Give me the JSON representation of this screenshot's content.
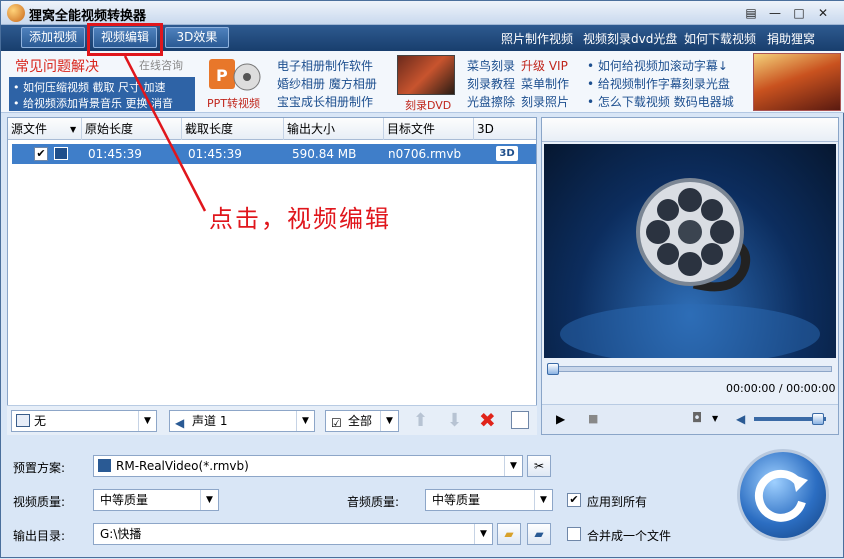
{
  "app": {
    "title": "狸窝全能视频转换器"
  },
  "window_controls": {
    "menu": "▤",
    "minimize": "—",
    "maximize": "□",
    "close": "✕"
  },
  "toolbar": {
    "add_video": "添加视频",
    "video_edit": "视频编辑",
    "effect_3d": "3D效果",
    "links": [
      "照片制作视频",
      "视频刻录dvd光盘",
      "如何下载视频",
      "捐助狸窝"
    ]
  },
  "ads": {
    "faq_title": "常见问题解决",
    "faq_online": "在线咨询",
    "faq_lines": [
      "• 如何压缩视频  截取  尺寸  加速",
      "• 给视频添加背景音乐  更换  消音"
    ],
    "ppt_label": "PPT转视频",
    "album_lines": [
      "电子相册制作软件",
      "婚纱相册  魔方相册",
      "宝宝成长相册制作"
    ],
    "dvd_label": "刻录DVD",
    "burn_lines_a": [
      "菜鸟刻录",
      "刻录教程",
      "光盘擦除"
    ],
    "burn_lines_b": [
      "升级 VIP",
      "菜单制作",
      "刻录照片"
    ],
    "tips": [
      "• 如何给视频加滚动字幕↓",
      "• 给视频制作字幕刻录光盘",
      "• 怎么下载视频  数码电器城"
    ]
  },
  "file_list": {
    "headers": [
      "源文件",
      "原始长度",
      "截取长度",
      "输出大小",
      "目标文件",
      "3D"
    ],
    "rows": [
      {
        "checked": "✔",
        "original_length": "01:45:39",
        "cut_length": "01:45:39",
        "output_size": "590.84 MB",
        "target": "n0706.rmvb",
        "badge_3d": "3D"
      }
    ]
  },
  "bottom_controls": {
    "subtitle": "无",
    "audio_track": "声道 1",
    "selection": "全部"
  },
  "player": {
    "time": "00:00:00 / 00:00:00",
    "volume_fraction": 0.8,
    "progress_fraction": 0.0
  },
  "settings": {
    "preset_label": "预置方案:",
    "preset_value": "RM-RealVideo(*.rmvb)",
    "video_quality_label": "视频质量:",
    "video_quality_value": "中等质量",
    "audio_quality_label": "音频质量:",
    "audio_quality_value": "中等质量",
    "apply_all_label": "应用到所有",
    "apply_all_checked": "✔",
    "output_dir_label": "输出目录:",
    "output_dir_value": "G:\\快播",
    "merge_label": "合并成一个文件"
  },
  "annotation": {
    "text": "点击，视频编辑"
  },
  "colors": {
    "accent": "#2a5a94",
    "annotation": "#e0161c",
    "selection": "#3f7ec9"
  }
}
